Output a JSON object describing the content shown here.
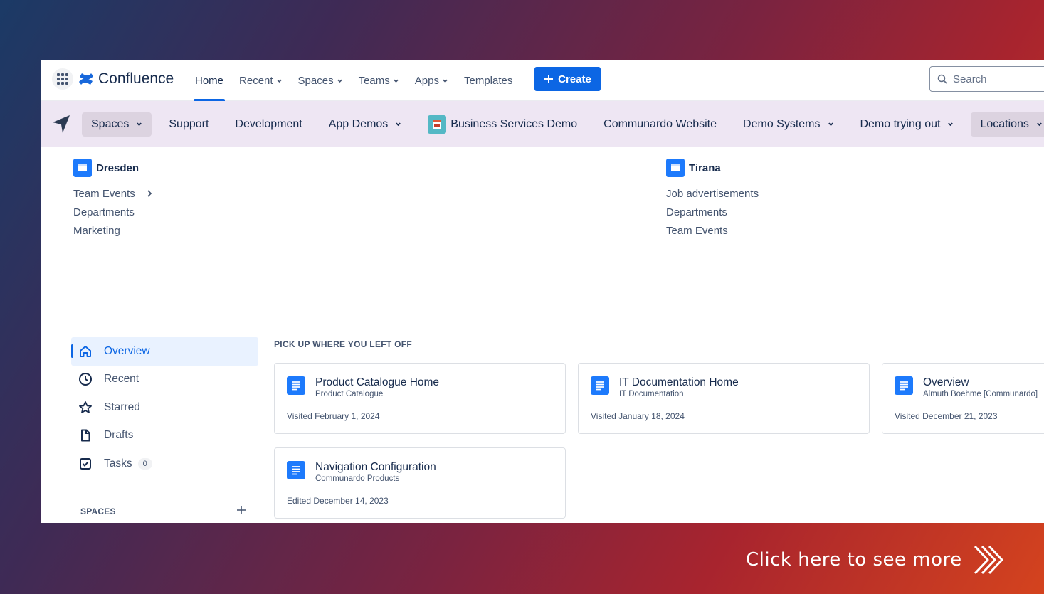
{
  "app": {
    "name": "Confluence"
  },
  "topnav": {
    "items": [
      {
        "label": "Home",
        "active": true,
        "dropdown": false
      },
      {
        "label": "Recent",
        "dropdown": true
      },
      {
        "label": "Spaces",
        "dropdown": true
      },
      {
        "label": "Teams",
        "dropdown": true
      },
      {
        "label": "Apps",
        "dropdown": true
      },
      {
        "label": "Templates",
        "dropdown": false
      }
    ],
    "create_label": "Create",
    "search_placeholder": "Search"
  },
  "navbar": {
    "items": [
      {
        "label": "Spaces",
        "dropdown": true,
        "highlight": true
      },
      {
        "label": "Support"
      },
      {
        "label": "Development"
      },
      {
        "label": "App Demos",
        "dropdown": true
      },
      {
        "label": "Business Services Demo",
        "icon": "coffee-icon"
      },
      {
        "label": "Communardo Website"
      },
      {
        "label": "Demo Systems",
        "dropdown": true
      },
      {
        "label": "Demo trying out",
        "dropdown": true
      },
      {
        "label": "Locations",
        "dropdown": true,
        "highlight": true
      }
    ]
  },
  "locations_menu": {
    "columns": [
      {
        "title": "Dresden",
        "links": [
          "Team Events",
          "Departments",
          "Marketing"
        ]
      },
      {
        "title": "Tirana",
        "links": [
          "Job advertisements",
          "Departments",
          "Team Events"
        ]
      }
    ]
  },
  "sidebar": {
    "items": [
      {
        "label": "Overview",
        "icon": "home-icon",
        "active": true
      },
      {
        "label": "Recent",
        "icon": "clock-icon"
      },
      {
        "label": "Starred",
        "icon": "star-icon"
      },
      {
        "label": "Drafts",
        "icon": "draft-icon"
      },
      {
        "label": "Tasks",
        "icon": "checkbox-icon",
        "count": "0"
      }
    ],
    "spaces_heading": "SPACES"
  },
  "main": {
    "section_title": "PICK UP WHERE YOU LEFT OFF",
    "cards": [
      {
        "title": "Product Catalogue Home",
        "subtitle": "Product Catalogue",
        "meta": "Visited February 1, 2024"
      },
      {
        "title": "IT Documentation Home",
        "subtitle": "IT Documentation",
        "meta": "Visited January 18, 2024"
      },
      {
        "title": "Overview",
        "subtitle": "Almuth Boehme [Communardo]",
        "meta": "Visited December 21, 2023"
      },
      {
        "title": "Navigation Configuration",
        "subtitle": "Communardo Products",
        "meta": "Edited December 14, 2023"
      }
    ]
  },
  "cta": {
    "label": "Click here to see more"
  },
  "colors": {
    "primary": "#0c66e4",
    "navbar_bg": "#eee6f3",
    "folder": "#1d7afc"
  }
}
